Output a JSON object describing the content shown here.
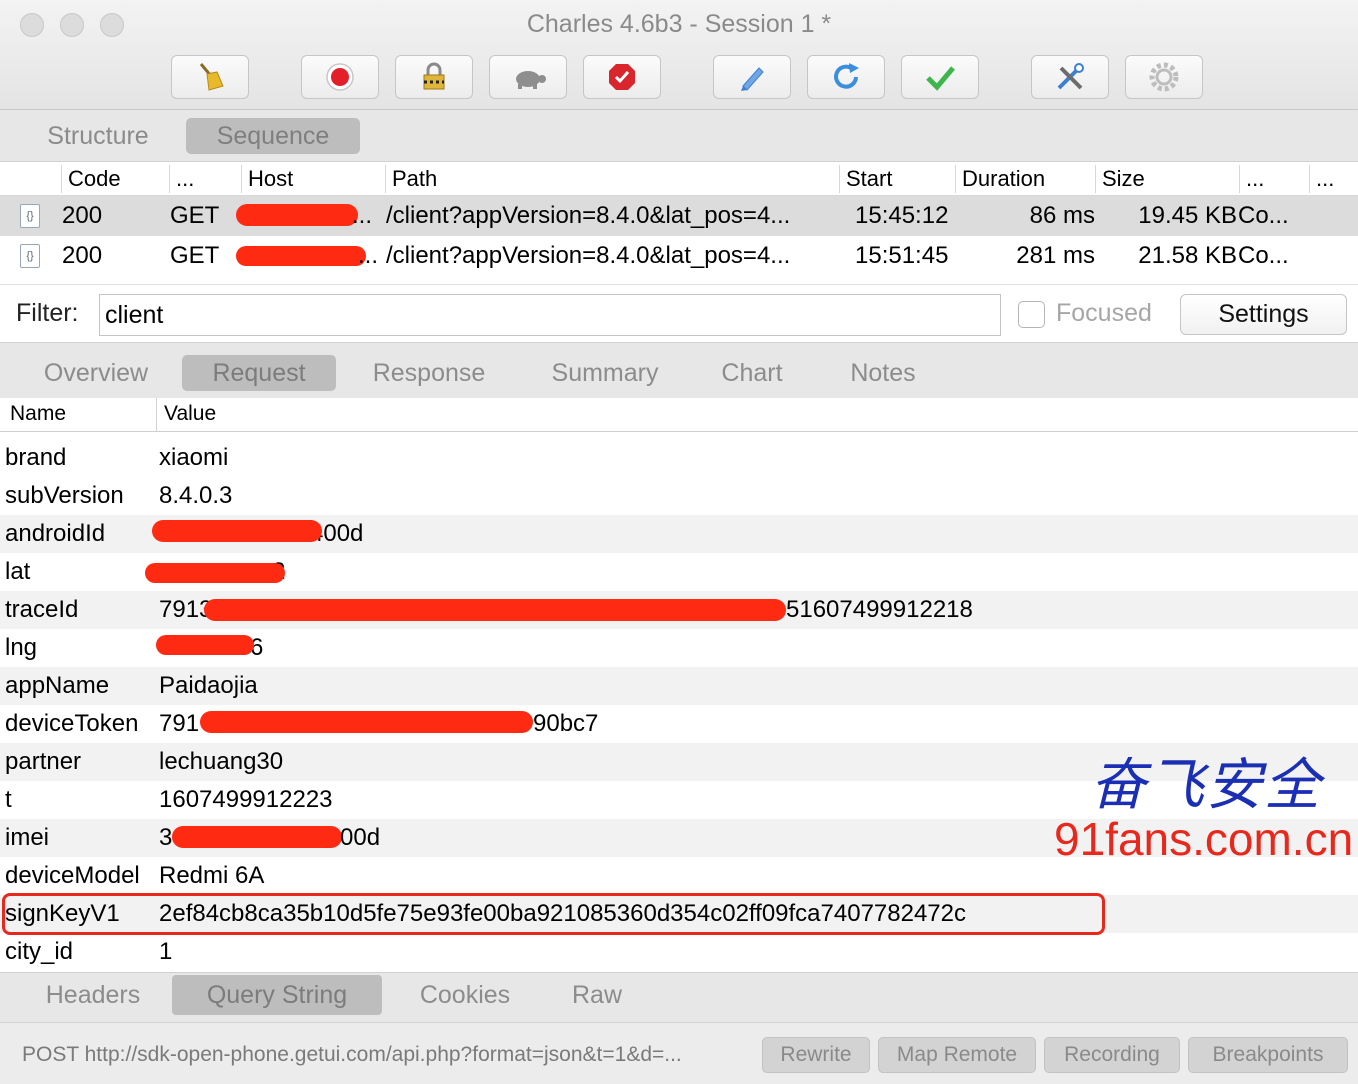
{
  "window": {
    "title": "Charles 4.6b3 - Session 1 *"
  },
  "toolbar": {
    "buttons": [
      {
        "name": "broom-icon",
        "color": "#e9b92c"
      },
      {
        "name": "record-icon",
        "color": "#e3202a"
      },
      {
        "name": "ssl-lock-icon",
        "color": "#c6a12a"
      },
      {
        "name": "throttle-turtle-icon",
        "color": "#7a7a7a"
      },
      {
        "name": "breakpoint-stop-icon",
        "color": "#d9262c"
      },
      {
        "name": "compose-pen-icon",
        "color": "#3f7fd1"
      },
      {
        "name": "repeat-refresh-icon",
        "color": "#3a8ede"
      },
      {
        "name": "validate-check-icon",
        "color": "#3cb54a"
      },
      {
        "name": "tools-icon",
        "color": "#3f7fd1"
      },
      {
        "name": "settings-gear-icon",
        "color": "#b8b8b8"
      }
    ]
  },
  "view_tabs": {
    "structure": "Structure",
    "sequence": "Sequence",
    "active": "Sequence"
  },
  "sequence_table": {
    "columns": [
      "Code",
      "...",
      "Host",
      "Path",
      "Start",
      "Duration",
      "Size",
      "...",
      "..."
    ],
    "rows": [
      {
        "code": "200",
        "method": "GET",
        "host_suffix": "...",
        "path": "/client?appVersion=8.4.0&lat_pos=4...",
        "start": "15:45:12",
        "duration": "86 ms",
        "size": "19.45 KB",
        "extra": "Co..."
      },
      {
        "code": "200",
        "method": "GET",
        "host_suffix": "...",
        "path": "/client?appVersion=8.4.0&lat_pos=4...",
        "start": "15:51:45",
        "duration": "281 ms",
        "size": "21.58 KB",
        "extra": "Co..."
      }
    ]
  },
  "filter": {
    "label": "Filter:",
    "value": "client",
    "focused_label": "Focused",
    "settings_label": "Settings"
  },
  "detail_tabs": {
    "overview": "Overview",
    "request": "Request",
    "response": "Response",
    "summary": "Summary",
    "chart": "Chart",
    "notes": "Notes",
    "active": "Request"
  },
  "query_table": {
    "name_header": "Name",
    "value_header": "Value",
    "rows": [
      {
        "name": "brand",
        "value": "xiaomi"
      },
      {
        "name": "subVersion",
        "value": "8.4.0.3"
      },
      {
        "name": "androidId",
        "value": "400d"
      },
      {
        "name": "lat",
        "value": "2"
      },
      {
        "name": "traceId",
        "value": "7913"
      },
      {
        "name": "lng",
        "value": "6"
      },
      {
        "name": "appName",
        "value": "Paidaojia"
      },
      {
        "name": "deviceToken",
        "value": "791"
      },
      {
        "name": "partner",
        "value": "lechuang30"
      },
      {
        "name": "t",
        "value": "1607499912223"
      },
      {
        "name": "imei",
        "value": "3"
      },
      {
        "name": "deviceModel",
        "value": "Redmi 6A"
      },
      {
        "name": "signKeyV1",
        "value": "2ef84cb8ca35b10d5fe75e93fe00ba921085360d354c02ff09fca7407782472c"
      },
      {
        "name": "city_id",
        "value": "1"
      }
    ],
    "value_tails": {
      "traceId": "51607499912218",
      "deviceToken": "90bc7",
      "imei": "00d"
    }
  },
  "watermark": {
    "cn": "奋飞安全",
    "url": "91fans.com.cn",
    "cn_color": "#1b2fb5",
    "url_color": "#e8281c"
  },
  "bottom_tabs": {
    "headers": "Headers",
    "query_string": "Query String",
    "cookies": "Cookies",
    "raw": "Raw",
    "active": "Query String"
  },
  "status_bar": {
    "text": "POST http://sdk-open-phone.getui.com/api.php?format=json&t=1&d=...",
    "rewrite": "Rewrite",
    "map_remote": "Map Remote",
    "recording": "Recording",
    "breakpoints": "Breakpoints"
  }
}
